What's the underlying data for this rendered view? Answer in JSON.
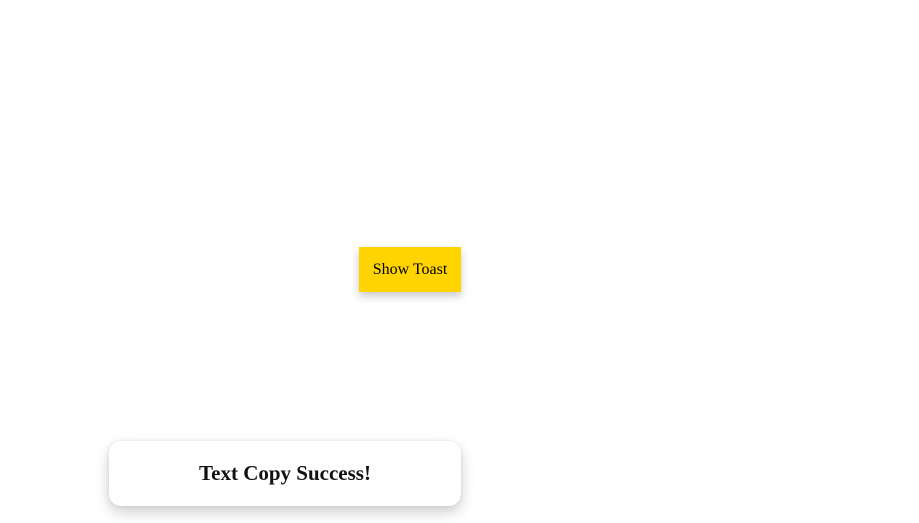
{
  "main": {
    "button_label": "Show Toast",
    "button_color": "#FFD400"
  },
  "toast": {
    "message": "Text Copy Success!",
    "background": "#FFFFFF"
  }
}
